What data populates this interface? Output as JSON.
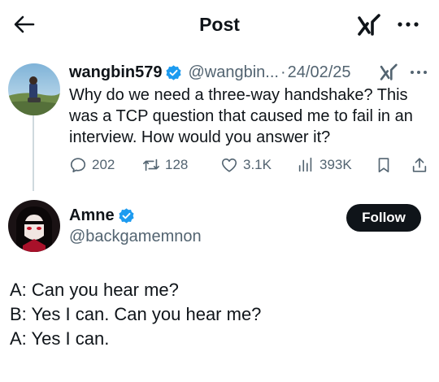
{
  "header": {
    "title": "Post",
    "back_icon": "arrow-left-icon",
    "grok_icon": "grok-icon",
    "more_icon": "more-horizontal-icon"
  },
  "tweet": {
    "author_name": "wangbin579",
    "handle": "@wangbin...",
    "separator": "·",
    "date": "24/02/25",
    "verified_color": "#1d9bf0",
    "text": "Why do we need a three-way handshake? This was a TCP question that caused me to fail in an interview. How would you answer it?",
    "stats": {
      "replies": "202",
      "reposts": "128",
      "likes": "3.1K",
      "views": "393K"
    }
  },
  "reply": {
    "author_name": "Amne",
    "handle": "@backgamemnon",
    "follow_label": "Follow",
    "lines": [
      "A: Can you hear me?",
      "B: Yes I can. Can you hear me?",
      "A: Yes I can."
    ]
  }
}
